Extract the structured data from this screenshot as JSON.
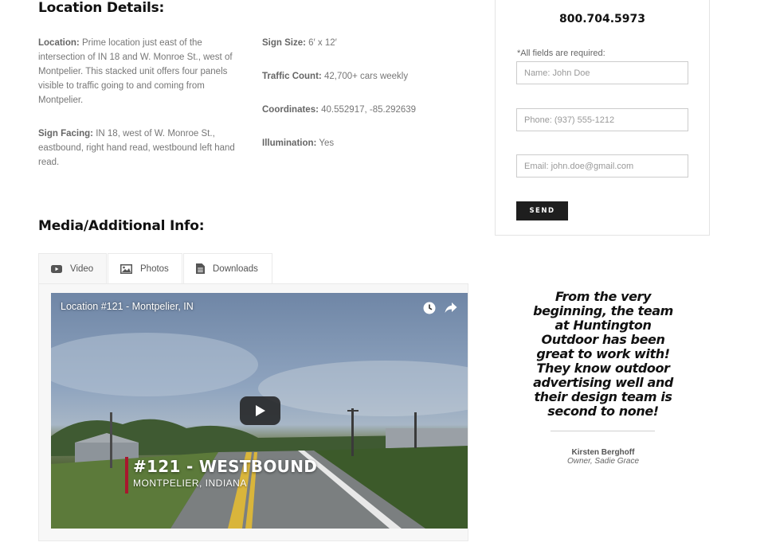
{
  "details": {
    "heading": "Location Details:",
    "location_label": "Location:",
    "location_text": "Prime location just east of the intersection of IN 18 and W. Monroe St., west of Montpelier. This stacked unit offers four panels visible to traffic going to and coming from Montpelier.",
    "facing_label": "Sign Facing:",
    "facing_text": "IN 18, west of W. Monroe St., eastbound, right hand read, westbound left hand read.",
    "size_label": "Sign Size:",
    "size_text": "6′ x 12′",
    "traffic_label": "Traffic Count:",
    "traffic_text": "42,700+ cars weekly",
    "coords_label": "Coordinates:",
    "coords_text": "40.552917, -85.292639",
    "illum_label": "Illumination:",
    "illum_text": "Yes"
  },
  "media": {
    "heading": "Media/Additional Info:",
    "tabs": [
      {
        "label": "Video",
        "icon": "youtube-icon"
      },
      {
        "label": "Photos",
        "icon": "image-icon"
      },
      {
        "label": "Downloads",
        "icon": "document-icon"
      }
    ],
    "video": {
      "title": "Location #121 - Montpelier, IN",
      "overlay_title": "#121 - WESTBOUND",
      "overlay_subtitle": "MONTPELIER, INDIANA"
    }
  },
  "contact": {
    "phone": "800.704.5973",
    "required_note": "*All fields are required:",
    "name_placeholder": "Name: John Doe",
    "phone_placeholder": "Phone: (937) 555-1212",
    "email_placeholder": "Email: john.doe@gmail.com",
    "send_label": "SEND"
  },
  "testimonial": {
    "quote": "From the very beginning, the team at Huntington Outdoor has been great to work with! They know outdoor advertising well and their design team is second to none!",
    "author": "Kirsten Berghoff",
    "role": "Owner, Sadie Grace"
  },
  "colors": {
    "accent_red": "#a8172d",
    "button_dark": "#1e1e1e"
  }
}
